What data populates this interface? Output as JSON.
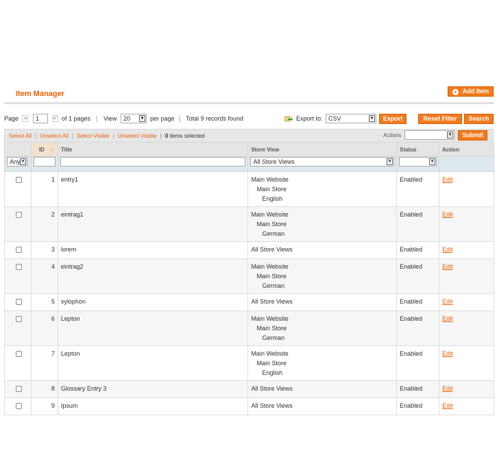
{
  "header": {
    "title": "Item Manager",
    "add_label": "Add Item"
  },
  "pager": {
    "page_label": "Page",
    "page_value": "1",
    "of_pages": "of 1 pages",
    "sep1": "|",
    "view_label": "View",
    "view_value": "20",
    "per_page": "per page",
    "sep2": "|",
    "records": "Total 9 records found"
  },
  "export": {
    "label": "Export to:",
    "format": "CSV",
    "button": "Export"
  },
  "buttons": {
    "reset": "Reset Filter",
    "search": "Search",
    "submit": "Submit"
  },
  "massaction": {
    "select_all": "Select All",
    "unselect_all": "Unselect All",
    "select_visible": "Select Visible",
    "unselect_visible": "Unselect Visible",
    "sep": "|",
    "selected_count": "0",
    "selected_label": "items selected",
    "actions_label": "Actions",
    "actions_value": ""
  },
  "columns": {
    "id": "ID",
    "title": "Title",
    "store_view": "Store View",
    "status": "Status",
    "action": "Action"
  },
  "filters": {
    "select": "Any",
    "store_view": "All Store Views",
    "status": ""
  },
  "rows": [
    {
      "id": "1",
      "title": "entry1",
      "store": [
        "Main Website",
        "Main Store",
        "English"
      ],
      "status": "Enabled",
      "action": "Edit"
    },
    {
      "id": "2",
      "title": "eintrag1",
      "store": [
        "Main Website",
        "Main Store",
        "German"
      ],
      "status": "Enabled",
      "action": "Edit"
    },
    {
      "id": "3",
      "title": "lorem",
      "store": [
        "All Store Views"
      ],
      "status": "Enabled",
      "action": "Edit"
    },
    {
      "id": "4",
      "title": "eintrag2",
      "store": [
        "Main Website",
        "Main Store",
        "German"
      ],
      "status": "Enabled",
      "action": "Edit"
    },
    {
      "id": "5",
      "title": "xylophon",
      "store": [
        "All Store Views"
      ],
      "status": "Enabled",
      "action": "Edit"
    },
    {
      "id": "6",
      "title": "Lepton",
      "store": [
        "Main Website",
        "Main Store",
        "German"
      ],
      "status": "Enabled",
      "action": "Edit"
    },
    {
      "id": "7",
      "title": "Lepton",
      "store": [
        "Main Website",
        "Main Store",
        "English"
      ],
      "status": "Enabled",
      "action": "Edit"
    },
    {
      "id": "8",
      "title": "Glossary Entry 3",
      "store": [
        "All Store Views"
      ],
      "status": "Enabled",
      "action": "Edit"
    },
    {
      "id": "9",
      "title": "Ipsum",
      "store": [
        "All Store Views"
      ],
      "status": "Enabled",
      "action": "Edit"
    }
  ],
  "icons": {
    "add": "plus-circle-icon",
    "sort": "sort-up-arrow-icon",
    "export": "export-arrow-icon",
    "dropdown": "chevron-down-icon"
  },
  "colors": {
    "accent": "#eb5e00",
    "button": "#f37b1d",
    "filter_row": "#dde9ee"
  }
}
